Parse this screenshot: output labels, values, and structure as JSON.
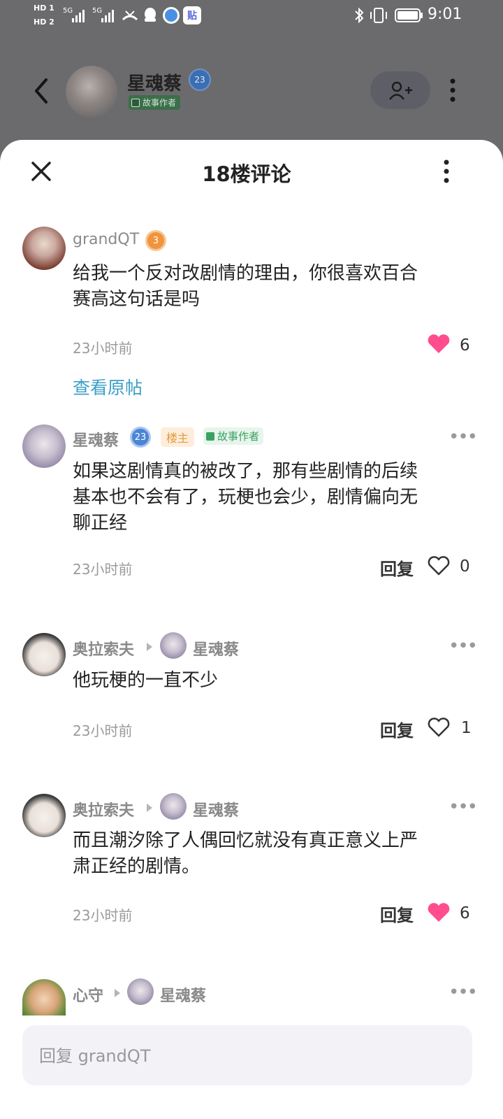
{
  "status_bar": {
    "hd1": "HD 1",
    "hd2": "HD 2",
    "signal1": "5G",
    "signal2": "5G",
    "time": "9:01",
    "app_badge": "贴"
  },
  "header": {
    "name": "星魂蔡",
    "level": "23",
    "tag": "故事作者"
  },
  "sheet": {
    "title": "18楼评论"
  },
  "main_comment": {
    "user": "grandQT",
    "level": "3",
    "text_line1": "给我一个反对改剧情的理由，你很喜欢百合",
    "text_line2": "赛高这句话是吗",
    "time": "23小时前",
    "likes": "6",
    "view_original": "查看原帖"
  },
  "replies": [
    {
      "user": "星魂蔡",
      "level": "23",
      "owner_tag": "楼主",
      "author_tag": "故事作者",
      "line1": "如果这剧情真的被改了，那有些剧情的后续",
      "line2": "基本也不会有了，玩梗也会少，剧情偏向无",
      "line3": "聊正经",
      "time": "23小时前",
      "reply_label": "回复",
      "likes": "0"
    },
    {
      "user": "奥拉索夫",
      "reply_to": "星魂蔡",
      "line1": "他玩梗的一直不少",
      "time": "23小时前",
      "reply_label": "回复",
      "likes": "1"
    },
    {
      "user": "奥拉索夫",
      "reply_to": "星魂蔡",
      "line1": "而且潮汐除了人偶回忆就没有真正意义上严",
      "line2": "肃正经的剧情。",
      "time": "23小时前",
      "reply_label": "回复",
      "likes": "6"
    },
    {
      "user": "心守",
      "reply_to": "星魂蔡"
    }
  ],
  "input": {
    "placeholder": "回复 grandQT"
  },
  "colors": {
    "like_active": "#ff4d8d",
    "link": "#3a9ec7",
    "level_blue": "#4b84d6",
    "level_orange": "#f0943d"
  }
}
